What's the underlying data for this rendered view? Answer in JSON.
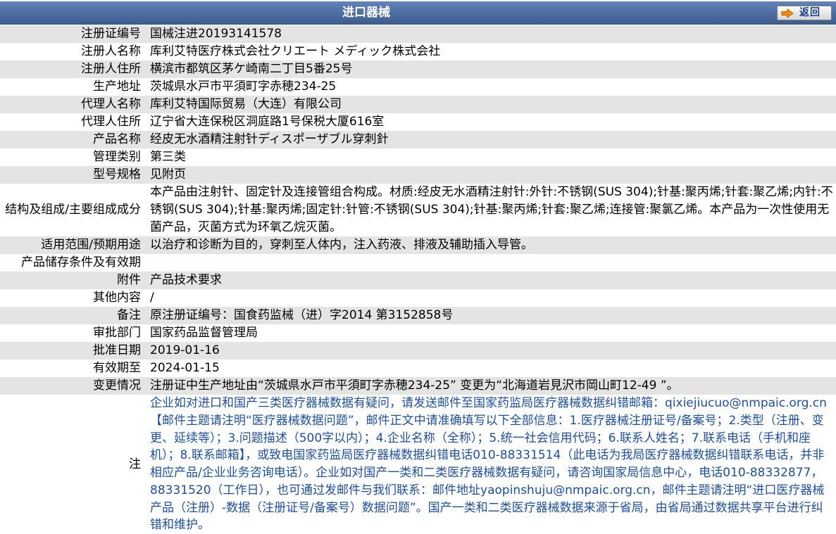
{
  "header": {
    "title": "进口器械",
    "back_label": "返回"
  },
  "icons": {
    "back": "arrow-right-icon"
  },
  "colors": {
    "header_top": "#6384b9",
    "header_bottom": "#3c5b8d",
    "row_alt": "#e4e4e4",
    "note_text": "#1d4f9e",
    "back_label": "#1b3f8b",
    "back_icon": "#f28c00"
  },
  "rows": [
    {
      "label": "注册证编号",
      "value": "国械注进20193141578"
    },
    {
      "label": "注册人名称",
      "value": "库利艾特医疗株式会社クリエート メディック株式会社"
    },
    {
      "label": "注册人住所",
      "value": "横滨市都筑区茅ケ崎南二丁目5番25号"
    },
    {
      "label": "生产地址",
      "value": "茨城県水戸市平須町字赤穂234-25"
    },
    {
      "label": "代理人名称",
      "value": "库利艾特国际贸易（大连）有限公司"
    },
    {
      "label": "代理人住所",
      "value": "辽宁省大连保税区洞庭路1号保税大厦616室"
    },
    {
      "label": "产品名称",
      "value": "经皮无水酒精注射针ディスポーザブル穿刺針"
    },
    {
      "label": "管理类别",
      "value": "第三类"
    },
    {
      "label": "型号规格",
      "value": "见附页"
    },
    {
      "label": "结构及组成/主要组成成分",
      "value": "本产品由注射针、固定针及连接管组合构成。材质:经皮无水酒精注射针:外针:不锈钢(SUS 304);针基:聚丙烯;针套:聚乙烯;内针:不锈钢(SUS 304);针基:聚丙烯;固定针:针管:不锈钢(SUS 304);针基:聚丙烯;针套:聚乙烯;连接管:聚氯乙烯。本产品为一次性使用无菌产品，灭菌方式为环氧乙烷灭菌。"
    },
    {
      "label": "适用范围/预期用途",
      "value": "以治疗和诊断为目的，穿刺至人体内，注入药液、排液及辅助插入导管。"
    },
    {
      "label": "产品储存条件及有效期",
      "value": ""
    },
    {
      "label": "附件",
      "value": "产品技术要求"
    },
    {
      "label": "其他内容",
      "value": "/"
    },
    {
      "label": "备注",
      "value": "原注册证编号：国食药监械（进）字2014 第3152858号"
    },
    {
      "label": "审批部门",
      "value": "国家药品监督管理局"
    },
    {
      "label": "批准日期",
      "value": "2019-01-16"
    },
    {
      "label": "有效期至",
      "value": "2024-01-15"
    },
    {
      "label": "变更情况",
      "value": "注册证中生产地址由“茨城県水戸市平須町字赤穂234-25” 变更为“北海道岩見沢市岡山町12-49 ”。"
    },
    {
      "label": "注",
      "value": "企业如对进口和国产三类医疗器械数据有疑问，请发送邮件至国家药监局医疗器械数据纠错邮箱：qixiejiucuo@nmpaic.org.cn【邮件主题请注明“医疗器械数据问题”，邮件正文中请准确填写以下全部信息：1.医疗器械注册证号/备案号；2.类型（注册、变更、延续等）；3.问题描述（500字以内）；4.企业名称（全称）；5.统一社会信用代码；6.联系人姓名；7.联系电话（手机和座机）；8.联系邮箱】，或致电国家药监局医疗器械数据纠错电话010-88331514（此电话为我局医疗器械数据纠错联系电话，并非相应产品/企业业务咨询电话）。企业如对国产一类和二类医疗器械数据有疑问，请咨询国家局信息中心，电话010-88332877，88331520（工作日），也可通过发邮件与我们联系：邮件地址yaopinshuju@nmpaic.org.cn，邮件主题请注明“进口医疗器械产品（注册）-数据（注册证号/备案号）数据问题”。国产一类和二类医疗器械数据来源于省局，由省局通过数据共享平台进行纠错和维护。"
    }
  ]
}
